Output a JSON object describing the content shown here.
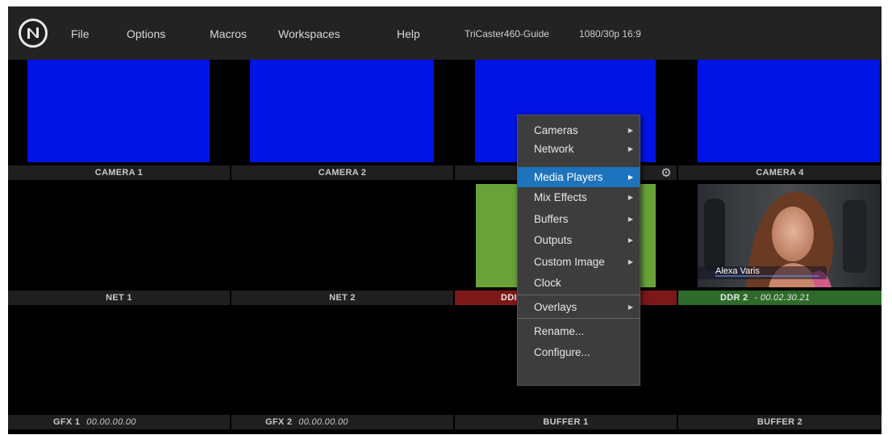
{
  "menubar": {
    "items": [
      "File",
      "Options",
      "Macros",
      "Workspaces",
      "Help"
    ],
    "session_name": "TriCaster460-Guide",
    "session_format": "1080/30p 16:9"
  },
  "colors": {
    "camera_blue": "#0014e6",
    "ddr_green": "#6aa23a",
    "ddr_red_tally": "#7d1818",
    "ddr_green_tally": "#2e6b2a",
    "menu_highlight": "#1e73bd"
  },
  "monitors": {
    "row1": [
      "CAMERA 1",
      "CAMERA 2",
      "",
      "CAMERA 4"
    ],
    "row2": {
      "net1": "NET 1",
      "net2": "NET 2",
      "ddr1": "DDI",
      "ddr2": "DDR 2",
      "ddr2_time": "- 00.02.30.21"
    },
    "row3": {
      "gfx1": "GFX 1",
      "gfx1_time": "00.00.00.00",
      "gfx2": "GFX 2",
      "gfx2_time": "00.00.00.00",
      "buffer1": "BUFFER 1",
      "buffer2": "BUFFER 2"
    },
    "thumbnail_caption": "Alexa Varis"
  },
  "context_menu": {
    "items": [
      {
        "label": "Cameras",
        "submenu": true
      },
      {
        "label": "Network",
        "submenu": true
      },
      {
        "label": "Media Players",
        "submenu": true,
        "selected": true
      },
      {
        "label": "Mix Effects",
        "submenu": true
      },
      {
        "label": "Buffers",
        "submenu": true
      },
      {
        "label": "Outputs",
        "submenu": true
      },
      {
        "label": "Custom Image",
        "submenu": true
      },
      {
        "label": "Clock",
        "submenu": false
      },
      {
        "label": "Overlays",
        "submenu": true
      },
      {
        "label": "Rename...",
        "submenu": false
      },
      {
        "label": "Configure...",
        "submenu": false
      }
    ]
  }
}
